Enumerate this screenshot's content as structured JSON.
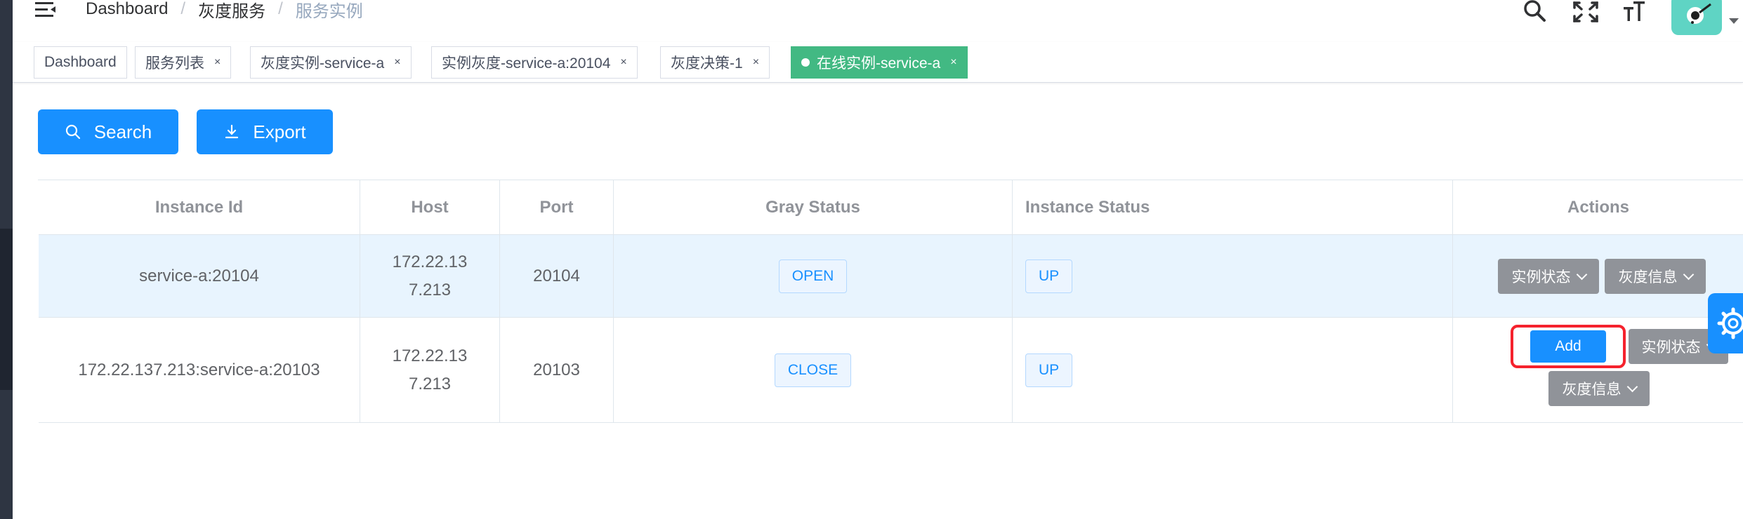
{
  "navbar": {
    "breadcrumb": [
      "Dashboard",
      "灰度服务",
      "服务实例"
    ]
  },
  "tags": [
    {
      "label": "Dashboard",
      "closable": false,
      "active": false
    },
    {
      "label": "服务列表",
      "closable": true,
      "active": false
    },
    {
      "label": "灰度实例-service-a",
      "closable": true,
      "active": false
    },
    {
      "label": "实例灰度-service-a:20104",
      "closable": true,
      "active": false
    },
    {
      "label": "灰度决策-1",
      "closable": true,
      "active": false
    },
    {
      "label": "在线实例-service-a",
      "closable": true,
      "active": true
    }
  ],
  "tag_close_glyph": "×",
  "toolbar": {
    "search_label": "Search",
    "export_label": "Export"
  },
  "table": {
    "headers": [
      "Instance Id",
      "Host",
      "Port",
      "Gray Status",
      "Instance Status",
      "Actions"
    ],
    "rows": [
      {
        "instance_id": "service-a:20104",
        "host": "172.22.137.213",
        "port": "20104",
        "gray_status": "OPEN",
        "instance_status": "UP"
      },
      {
        "instance_id": "172.22.137.213:service-a:20103",
        "host": "172.22.137.213",
        "port": "20103",
        "gray_status": "CLOSE",
        "instance_status": "UP"
      }
    ],
    "actions": {
      "instance_status_label": "实例状态",
      "gray_info_label": "灰度信息",
      "add_label": "Add"
    }
  },
  "colors": {
    "primary": "#1890ff",
    "active_tag": "#42b983",
    "gray_button": "#909399",
    "highlight": "#f5222d",
    "stripe": "#e8f4fe"
  }
}
